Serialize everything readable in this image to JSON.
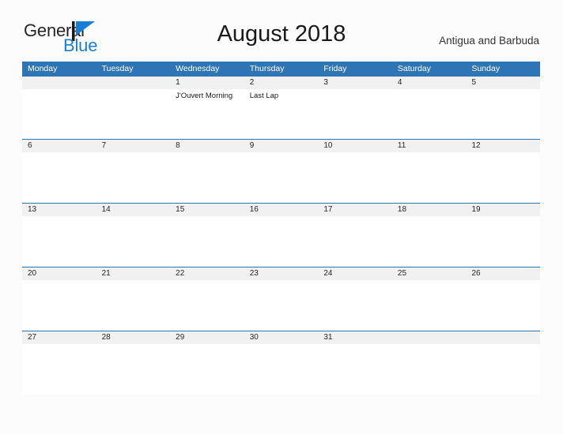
{
  "logo": {
    "word_dark": "General",
    "word_blue": "Blue",
    "flag_icon": "blue-flag-icon",
    "flag_color": "#1a7fd4"
  },
  "header": {
    "title": "August 2018",
    "region": "Antigua and Barbuda"
  },
  "colors": {
    "header_blue": "#2e75b6",
    "date_band_gray": "#f1f1f1",
    "logo_blue": "#1a7fd4",
    "page_background": "#fcfcfd",
    "text_dark": "#1a1a1a"
  },
  "calendar": {
    "day_headers": [
      "Monday",
      "Tuesday",
      "Wednesday",
      "Thursday",
      "Friday",
      "Saturday",
      "Sunday"
    ],
    "weeks": [
      {
        "days": [
          {
            "date": "",
            "events": []
          },
          {
            "date": "",
            "events": []
          },
          {
            "date": "1",
            "events": [
              "J'Ouvert Morning"
            ]
          },
          {
            "date": "2",
            "events": [
              "Last Lap"
            ]
          },
          {
            "date": "3",
            "events": []
          },
          {
            "date": "4",
            "events": []
          },
          {
            "date": "5",
            "events": []
          }
        ]
      },
      {
        "days": [
          {
            "date": "6",
            "events": []
          },
          {
            "date": "7",
            "events": []
          },
          {
            "date": "8",
            "events": []
          },
          {
            "date": "9",
            "events": []
          },
          {
            "date": "10",
            "events": []
          },
          {
            "date": "11",
            "events": []
          },
          {
            "date": "12",
            "events": []
          }
        ]
      },
      {
        "days": [
          {
            "date": "13",
            "events": []
          },
          {
            "date": "14",
            "events": []
          },
          {
            "date": "15",
            "events": []
          },
          {
            "date": "16",
            "events": []
          },
          {
            "date": "17",
            "events": []
          },
          {
            "date": "18",
            "events": []
          },
          {
            "date": "19",
            "events": []
          }
        ]
      },
      {
        "days": [
          {
            "date": "20",
            "events": []
          },
          {
            "date": "21",
            "events": []
          },
          {
            "date": "22",
            "events": []
          },
          {
            "date": "23",
            "events": []
          },
          {
            "date": "24",
            "events": []
          },
          {
            "date": "25",
            "events": []
          },
          {
            "date": "26",
            "events": []
          }
        ]
      },
      {
        "days": [
          {
            "date": "27",
            "events": []
          },
          {
            "date": "28",
            "events": []
          },
          {
            "date": "29",
            "events": []
          },
          {
            "date": "30",
            "events": []
          },
          {
            "date": "31",
            "events": []
          },
          {
            "date": "",
            "events": []
          },
          {
            "date": "",
            "events": []
          }
        ]
      }
    ]
  }
}
